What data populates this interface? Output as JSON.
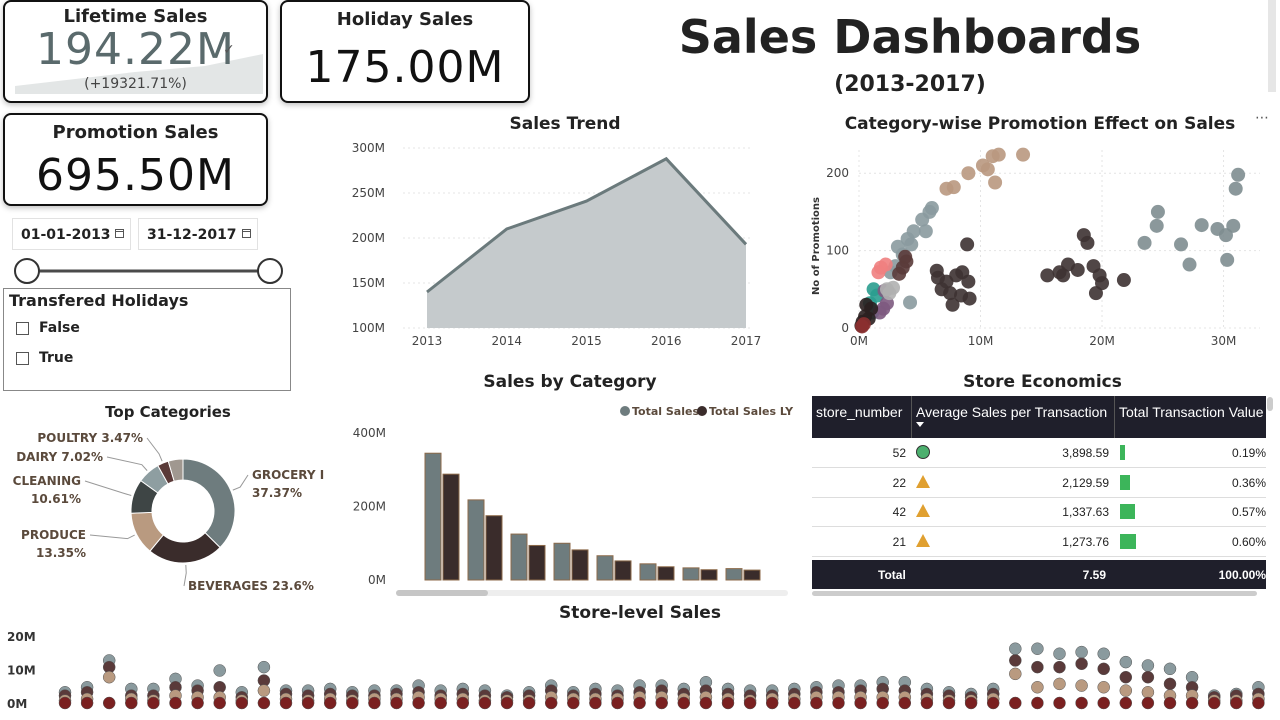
{
  "kpi": {
    "lifetime": {
      "label": "Lifetime Sales",
      "value": "194.22M",
      "change": "(+19321.71%)"
    },
    "holiday": {
      "label": "Holiday Sales",
      "value": "175.00M"
    },
    "promotion": {
      "label": "Promotion Sales",
      "value": "695.50M"
    }
  },
  "header": {
    "title": "Sales Dashboards",
    "subtitle": "(2013-2017)"
  },
  "date_slicer": {
    "start": "01-01-2013",
    "end": "31-12-2017",
    "range": [
      0,
      1
    ]
  },
  "holiday_slicer": {
    "title": "Transfered Holidays",
    "options": [
      "False",
      "True"
    ]
  },
  "colors": {
    "area": "#c5cacc",
    "area_line": "#6b7a7c",
    "bar_ts": "#6e7c7e",
    "bar_ly": "#3a2c2b",
    "bar_edge": "#8c6a4a",
    "dark": "#1f1f2b",
    "green": "#3cb55a",
    "triangle": "#e0a030",
    "circle_ok": "#4caf6e"
  },
  "chart_data": [
    {
      "id": "sales-trend",
      "type": "area",
      "title": "Sales Trend",
      "x": [
        "2013",
        "2014",
        "2015",
        "2016",
        "2017"
      ],
      "values": [
        140,
        210,
        241,
        288,
        193
      ],
      "yticks": [
        "300M",
        "250M",
        "200M",
        "150M",
        "100M"
      ],
      "ylim": [
        100,
        300
      ],
      "grid": true
    },
    {
      "id": "promo-effect",
      "type": "scatter",
      "title": "Category-wise Promotion Effect on Sales",
      "ylabel": "No of Promotions",
      "xticks": [
        "0M",
        "10M",
        "20M",
        "30M"
      ],
      "yticks": [
        "200",
        "100",
        "0"
      ],
      "xlim": [
        0,
        33
      ],
      "ylim": [
        0,
        230
      ],
      "grid": true,
      "series": [
        {
          "color": "#b99880",
          "points": [
            [
              7.2,
              180
            ],
            [
              7.8,
              182
            ],
            [
              9,
              200
            ],
            [
              10.2,
              210
            ],
            [
              11,
              222
            ],
            [
              11.5,
              224
            ],
            [
              11.2,
              188
            ],
            [
              13.5,
              224
            ],
            [
              10.6,
              205
            ]
          ]
        },
        {
          "color": "#8a9a9e",
          "points": [
            [
              3.2,
              105
            ],
            [
              4,
              115
            ],
            [
              4.5,
              125
            ],
            [
              5.2,
              140
            ],
            [
              5.8,
              150
            ],
            [
              6,
              155
            ],
            [
              4.3,
              108
            ],
            [
              3.6,
              95
            ],
            [
              3,
              80
            ],
            [
              2.6,
              72
            ],
            [
              4.2,
              33
            ],
            [
              5.5,
              125
            ]
          ]
        },
        {
          "color": "#3d3232",
          "points": [
            [
              6.5,
              65
            ],
            [
              7.2,
              60
            ],
            [
              8,
              68
            ],
            [
              8.5,
              72
            ],
            [
              9,
              60
            ],
            [
              6.8,
              50
            ],
            [
              7.5,
              45
            ],
            [
              8.4,
              42
            ],
            [
              9.1,
              38
            ],
            [
              6.4,
              74
            ],
            [
              8.9,
              108
            ],
            [
              7.7,
              30
            ],
            [
              15.5,
              68
            ],
            [
              16.5,
              72
            ],
            [
              17.2,
              82
            ],
            [
              18,
              75
            ],
            [
              18.5,
              120
            ],
            [
              18.8,
              110
            ],
            [
              19.3,
              80
            ],
            [
              19.8,
              68
            ],
            [
              20,
              58
            ],
            [
              21.8,
              62
            ],
            [
              16.8,
              68
            ],
            [
              19.5,
              45
            ]
          ]
        },
        {
          "color": "#7e8d90",
          "points": [
            [
              23.5,
              110
            ],
            [
              24.5,
              132
            ],
            [
              24.6,
              150
            ],
            [
              26.5,
              108
            ],
            [
              27.2,
              82
            ],
            [
              28.2,
              133
            ],
            [
              29.5,
              128
            ],
            [
              30.2,
              120
            ],
            [
              30.8,
              132
            ],
            [
              31,
              180
            ],
            [
              31.2,
              198
            ],
            [
              30.3,
              88
            ]
          ]
        },
        {
          "color": "#5a3b3a",
          "points": [
            [
              3.6,
              78
            ],
            [
              3.9,
              86
            ],
            [
              3.8,
              92
            ],
            [
              3.3,
              70
            ]
          ]
        },
        {
          "color": "#f08080",
          "points": [
            [
              1.8,
              78
            ],
            [
              2.2,
              82
            ],
            [
              1.6,
              72
            ]
          ]
        },
        {
          "color": "#2a9d8f",
          "points": [
            [
              1.2,
              50
            ],
            [
              1.5,
              42
            ],
            [
              0.9,
              32
            ],
            [
              1.1,
              20
            ]
          ]
        },
        {
          "color": "#7d5a80",
          "points": [
            [
              2,
              25
            ],
            [
              2.3,
              32
            ],
            [
              1.7,
              20
            ],
            [
              2.1,
              48
            ]
          ]
        },
        {
          "color": "#b0b0b0",
          "points": [
            [
              2.5,
              45
            ],
            [
              2.3,
              50
            ],
            [
              2.8,
              52
            ]
          ]
        },
        {
          "color": "#2b2020",
          "points": [
            [
              0.3,
              8
            ],
            [
              0.5,
              15
            ],
            [
              0.8,
              12
            ],
            [
              0.2,
              3
            ],
            [
              1,
              25
            ],
            [
              0.6,
              30
            ]
          ]
        },
        {
          "color": "#8b3030",
          "points": [
            [
              0.4,
              5
            ],
            [
              0.25,
              2
            ]
          ]
        }
      ]
    },
    {
      "id": "top-categories",
      "type": "pie",
      "title": "Top Categories",
      "slices": [
        {
          "label": "GROCERY I",
          "value": 37.37,
          "text": "37.37%",
          "color": "#6e7c7e"
        },
        {
          "label": "BEVERAGES",
          "value": 23.6,
          "text": "23.6%",
          "color": "#3a2c2b"
        },
        {
          "label": "PRODUCE",
          "value": 13.35,
          "text": "13.35%",
          "color": "#b99a80"
        },
        {
          "label": "CLEANING",
          "value": 10.61,
          "text": "10.61%",
          "color": "#3e4545"
        },
        {
          "label": "DAIRY",
          "value": 7.02,
          "text": "7.02%",
          "color": "#8e9ea1"
        },
        {
          "label": "POULTRY",
          "value": 3.47,
          "text": "3.47%",
          "color": "#5a3a38"
        },
        {
          "label": "",
          "value": 4.58,
          "text": "",
          "color": "#a09890"
        }
      ]
    },
    {
      "id": "sales-by-category",
      "type": "bar",
      "title": "Sales by Category",
      "legend": [
        "Total Sales",
        "Total Sales LY"
      ],
      "yticks": [
        "400M",
        "200M",
        "0M"
      ],
      "ylim": [
        0,
        400
      ],
      "series": [
        {
          "name": "Total Sales",
          "values": [
            345,
            218,
            125,
            100,
            66,
            44,
            33,
            31
          ]
        },
        {
          "name": "Total Sales LY",
          "values": [
            288,
            175,
            94,
            82,
            52,
            36,
            28,
            27
          ]
        }
      ]
    },
    {
      "id": "store-level-sales",
      "type": "scatter",
      "title": "Store-level Sales",
      "yticks": [
        "20M",
        "10M",
        "0M"
      ],
      "ylim": [
        0,
        20
      ],
      "stores": [
        [
          3.5,
          2.5,
          1
        ],
        [
          5,
          3.5,
          1.5
        ],
        [
          13,
          11,
          8
        ],
        [
          4.5,
          2.5,
          1.5
        ],
        [
          4.5,
          2.5,
          1
        ],
        [
          7.5,
          5,
          2.5
        ],
        [
          5.5,
          4,
          2
        ],
        [
          10,
          5,
          2
        ],
        [
          3.5,
          2,
          1
        ],
        [
          11,
          7,
          4
        ],
        [
          4,
          3,
          1.5
        ],
        [
          4,
          2.5,
          1
        ],
        [
          4.5,
          3,
          1.5
        ],
        [
          3.5,
          2.5,
          1
        ],
        [
          4,
          2.5,
          1.5
        ],
        [
          4,
          3,
          1.5
        ],
        [
          5.5,
          3.5,
          2
        ],
        [
          4,
          2.5,
          1.5
        ],
        [
          4.5,
          3,
          1.5
        ],
        [
          4,
          2.5,
          1
        ],
        [
          2.5,
          2,
          1
        ],
        [
          3.5,
          2.5,
          1
        ],
        [
          5.5,
          4,
          2
        ],
        [
          3.5,
          2.5,
          1.5
        ],
        [
          4.5,
          3,
          1.5
        ],
        [
          4,
          2.5,
          1.5
        ],
        [
          5.5,
          3.5,
          2
        ],
        [
          5.5,
          4,
          2
        ],
        [
          4.5,
          3,
          1.5
        ],
        [
          6.5,
          4,
          2
        ],
        [
          4.5,
          3,
          1.5
        ],
        [
          4,
          2.5,
          1
        ],
        [
          4,
          2.5,
          1.5
        ],
        [
          4.5,
          3,
          1.5
        ],
        [
          5,
          3.5,
          2
        ],
        [
          5.5,
          3.5,
          2
        ],
        [
          5.5,
          4,
          2
        ],
        [
          6.5,
          4.5,
          2
        ],
        [
          6.5,
          4,
          2
        ],
        [
          4.5,
          3,
          1.5
        ],
        [
          3.5,
          2.5,
          1
        ],
        [
          3,
          2,
          1
        ],
        [
          4.5,
          3,
          1.5
        ],
        [
          16.5,
          13,
          9
        ],
        [
          16.5,
          11,
          5
        ],
        [
          15,
          11,
          6
        ],
        [
          15.5,
          12,
          5.5
        ],
        [
          15,
          10.5,
          5
        ],
        [
          12.5,
          8,
          4
        ],
        [
          11.5,
          8,
          3.5
        ],
        [
          10.5,
          6,
          2.5
        ],
        [
          8,
          5,
          2.5
        ],
        [
          2.5,
          2,
          1
        ],
        [
          3,
          2.5,
          1
        ],
        [
          5,
          3,
          1.5
        ]
      ]
    }
  ],
  "store_table": {
    "title": "Store Economics",
    "columns": [
      "store_number",
      "Average Sales per Transaction",
      "Total Transaction Value"
    ],
    "rows": [
      {
        "store": "52",
        "icon": "circle",
        "avg": "3,898.59",
        "pct": "0.19%",
        "pct_value": 0.19
      },
      {
        "store": "22",
        "icon": "triangle",
        "avg": "2,129.59",
        "pct": "0.36%",
        "pct_value": 0.36
      },
      {
        "store": "42",
        "icon": "triangle",
        "avg": "1,337.63",
        "pct": "0.57%",
        "pct_value": 0.57
      },
      {
        "store": "21",
        "icon": "triangle",
        "avg": "1,273.76",
        "pct": "0.60%",
        "pct_value": 0.6
      }
    ],
    "total": {
      "label": "Total",
      "avg": "7.59",
      "pct": "100.00%"
    }
  }
}
